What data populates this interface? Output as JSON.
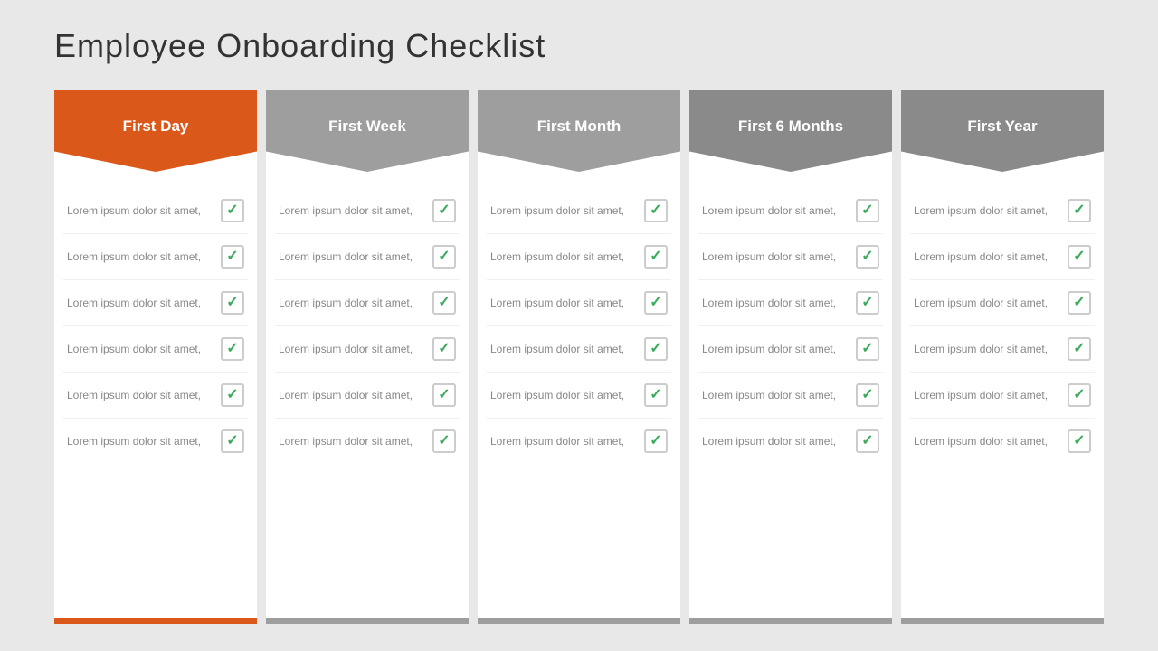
{
  "title": "Employee  Onboarding Checklist",
  "columns": [
    {
      "id": "first-day",
      "label": "First Day",
      "headerClass": "orange",
      "footerClass": "orange",
      "items": [
        {
          "text": "Lorem ipsum dolor sit amet,"
        },
        {
          "text": "Lorem ipsum dolor sit amet,"
        },
        {
          "text": "Lorem ipsum dolor sit amet,"
        },
        {
          "text": "Lorem ipsum dolor sit amet,"
        },
        {
          "text": "Lorem ipsum dolor sit amet,"
        },
        {
          "text": "Lorem ipsum dolor sit amet,"
        }
      ]
    },
    {
      "id": "first-week",
      "label": "First Week",
      "headerClass": "gray1",
      "footerClass": "gray",
      "items": [
        {
          "text": "Lorem ipsum dolor sit amet,"
        },
        {
          "text": "Lorem ipsum dolor sit amet,"
        },
        {
          "text": "Lorem ipsum dolor sit amet,"
        },
        {
          "text": "Lorem ipsum dolor sit amet,"
        },
        {
          "text": "Lorem ipsum dolor sit amet,"
        },
        {
          "text": "Lorem ipsum dolor sit amet,"
        }
      ]
    },
    {
      "id": "first-month",
      "label": "First Month",
      "headerClass": "gray2",
      "footerClass": "gray",
      "items": [
        {
          "text": "Lorem ipsum dolor sit amet,"
        },
        {
          "text": "Lorem ipsum dolor sit amet,"
        },
        {
          "text": "Lorem ipsum dolor sit amet,"
        },
        {
          "text": "Lorem ipsum dolor sit amet,"
        },
        {
          "text": "Lorem ipsum dolor sit amet,"
        },
        {
          "text": "Lorem ipsum dolor sit amet,"
        }
      ]
    },
    {
      "id": "first-6-months",
      "label": "First 6 Months",
      "headerClass": "gray3",
      "footerClass": "gray",
      "items": [
        {
          "text": "Lorem ipsum dolor sit amet,"
        },
        {
          "text": "Lorem ipsum dolor sit amet,"
        },
        {
          "text": "Lorem ipsum dolor sit amet,"
        },
        {
          "text": "Lorem ipsum dolor sit amet,"
        },
        {
          "text": "Lorem ipsum dolor sit amet,"
        },
        {
          "text": "Lorem ipsum dolor sit amet,"
        }
      ]
    },
    {
      "id": "first-year",
      "label": "First Year",
      "headerClass": "gray4",
      "footerClass": "gray",
      "items": [
        {
          "text": "Lorem ipsum dolor sit amet,"
        },
        {
          "text": "Lorem ipsum dolor sit amet,"
        },
        {
          "text": "Lorem ipsum dolor sit amet,"
        },
        {
          "text": "Lorem ipsum dolor sit amet,"
        },
        {
          "text": "Lorem ipsum dolor sit amet,"
        },
        {
          "text": "Lorem ipsum dolor sit amet,"
        }
      ]
    }
  ],
  "checkmark": "✓"
}
